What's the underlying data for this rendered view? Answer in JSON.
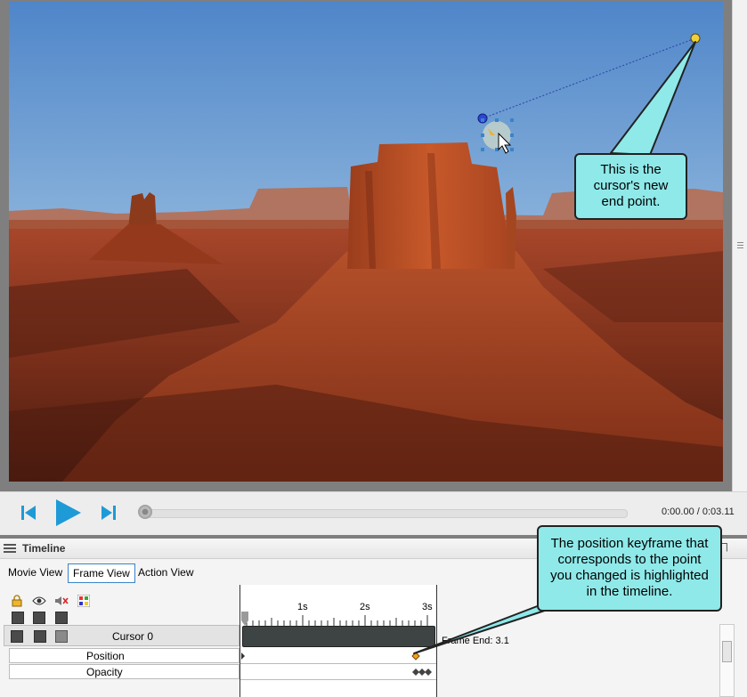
{
  "preview": {
    "callout_text": "This is the cursor's new end point."
  },
  "transport": {
    "time": "0:00.00 / 0:03.11",
    "progress": 0.0
  },
  "timeline": {
    "title": "Timeline",
    "pin_icon": "pin-icon",
    "tabs": [
      "Movie View",
      "Frame View",
      "Action View"
    ],
    "active_tab": "Frame View",
    "ruler_labels": [
      "1s",
      "2s",
      "3s"
    ],
    "track_name": "Cursor 0",
    "properties": [
      "Position",
      "Opacity"
    ],
    "frame_end": "Frame End: 3.1",
    "callout_text": "The position keyframe that corresponds to the point you changed is highlighted in the timeline.",
    "header_icons": [
      "lock-icon",
      "eye-icon",
      "mute-icon",
      "color-icon"
    ]
  },
  "colors": {
    "callout_fill": "#8fe9e9",
    "play_blue": "#1e9ad6",
    "keyframe_highlight": "#f3a21e"
  }
}
